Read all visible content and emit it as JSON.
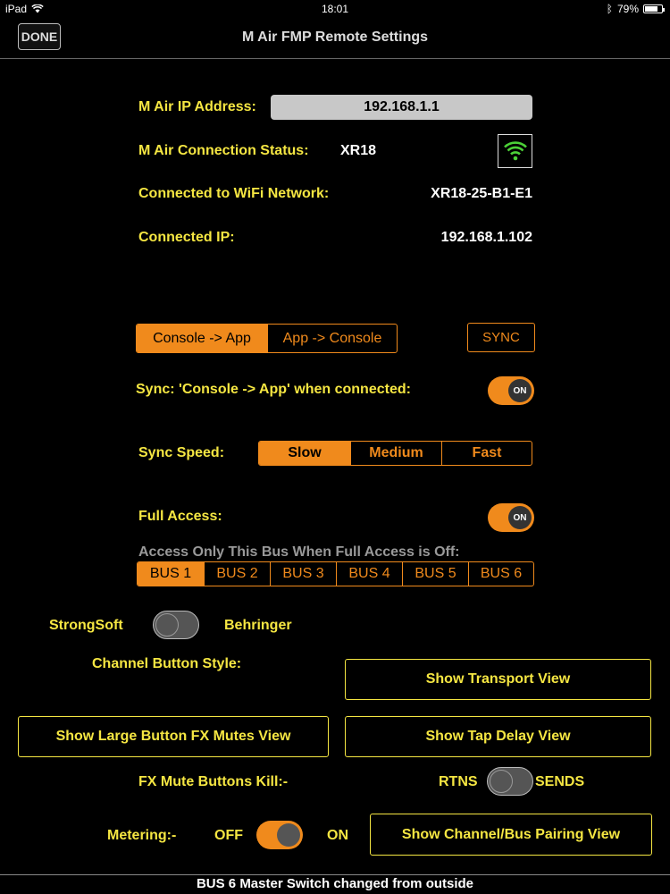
{
  "status_bar": {
    "device": "iPad",
    "time": "18:01",
    "battery": "79%",
    "battery_level": 0.79
  },
  "nav": {
    "done": "DONE",
    "title": "M Air FMP Remote Settings"
  },
  "info": {
    "ip_label": "M Air IP Address:",
    "ip_value": "192.168.1.1",
    "status_label": "M Air Connection Status:",
    "status_value": "XR18",
    "wifi_label": "Connected to WiFi Network:",
    "wifi_value": "XR18-25-B1-E1",
    "cip_label": "Connected IP:",
    "cip_value": "192.168.1.102"
  },
  "direction": {
    "options": [
      "Console -> App",
      "App -> Console"
    ],
    "selected": 0,
    "sync_button": "SYNC"
  },
  "sync_on_connect": {
    "label": "Sync: 'Console -> App' when connected:",
    "state": "ON"
  },
  "sync_speed": {
    "label": "Sync Speed:",
    "options": [
      "Slow",
      "Medium",
      "Fast"
    ],
    "selected": 0
  },
  "full_access": {
    "label": "Full Access:",
    "state": "ON"
  },
  "bus_access": {
    "label": "Access Only This Bus When Full Access is Off:",
    "options": [
      "BUS 1",
      "BUS 2",
      "BUS 3",
      "BUS 4",
      "BUS 5",
      "BUS 6"
    ],
    "selected": 0
  },
  "style_switch": {
    "left": "StrongSoft",
    "right": "Behringer"
  },
  "channel_button_style": {
    "label": "Channel Button Style:"
  },
  "buttons": {
    "transport": "Show Transport View",
    "large_fx": "Show Large Button FX Mutes View",
    "tap_delay": "Show Tap Delay View",
    "pairing": "Show Channel/Bus Pairing View"
  },
  "fx_mute": {
    "label": "FX Mute Buttons Kill:-",
    "left": "RTNS",
    "right": "SENDS"
  },
  "metering": {
    "label": "Metering:-",
    "off": "OFF",
    "on": "ON"
  },
  "footer": {
    "message": "BUS 6 Master Switch changed from outside"
  },
  "colors": {
    "accent": "#f08a1c",
    "label": "#f5e642",
    "background": "#000000"
  }
}
